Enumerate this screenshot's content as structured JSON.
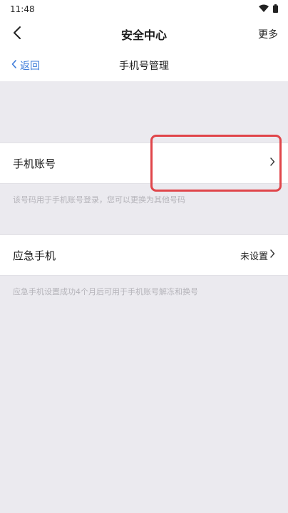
{
  "status_bar": {
    "time": "11:48",
    "wifi_icon": "wifi-icon",
    "battery_icon": "battery-icon"
  },
  "header": {
    "title": "安全中心",
    "more_label": "更多",
    "back_icon": "chevron-left-icon"
  },
  "sub_header": {
    "back_label": "返回",
    "title": "手机号管理",
    "back_icon": "chevron-left-icon"
  },
  "phone_account": {
    "label": "手机账号",
    "chevron_icon": "chevron-right-icon",
    "hint": "该号码用于手机账号登录，您可以更换为其他号码"
  },
  "emergency_phone": {
    "label": "应急手机",
    "status": "未设置",
    "chevron_icon": "chevron-right-icon",
    "hint": "应急手机设置成功4个月后可用于手机账号解冻和换号"
  },
  "colors": {
    "accent": "#3b7ad9",
    "highlight": "#e0454a",
    "background": "#ebeaef"
  }
}
